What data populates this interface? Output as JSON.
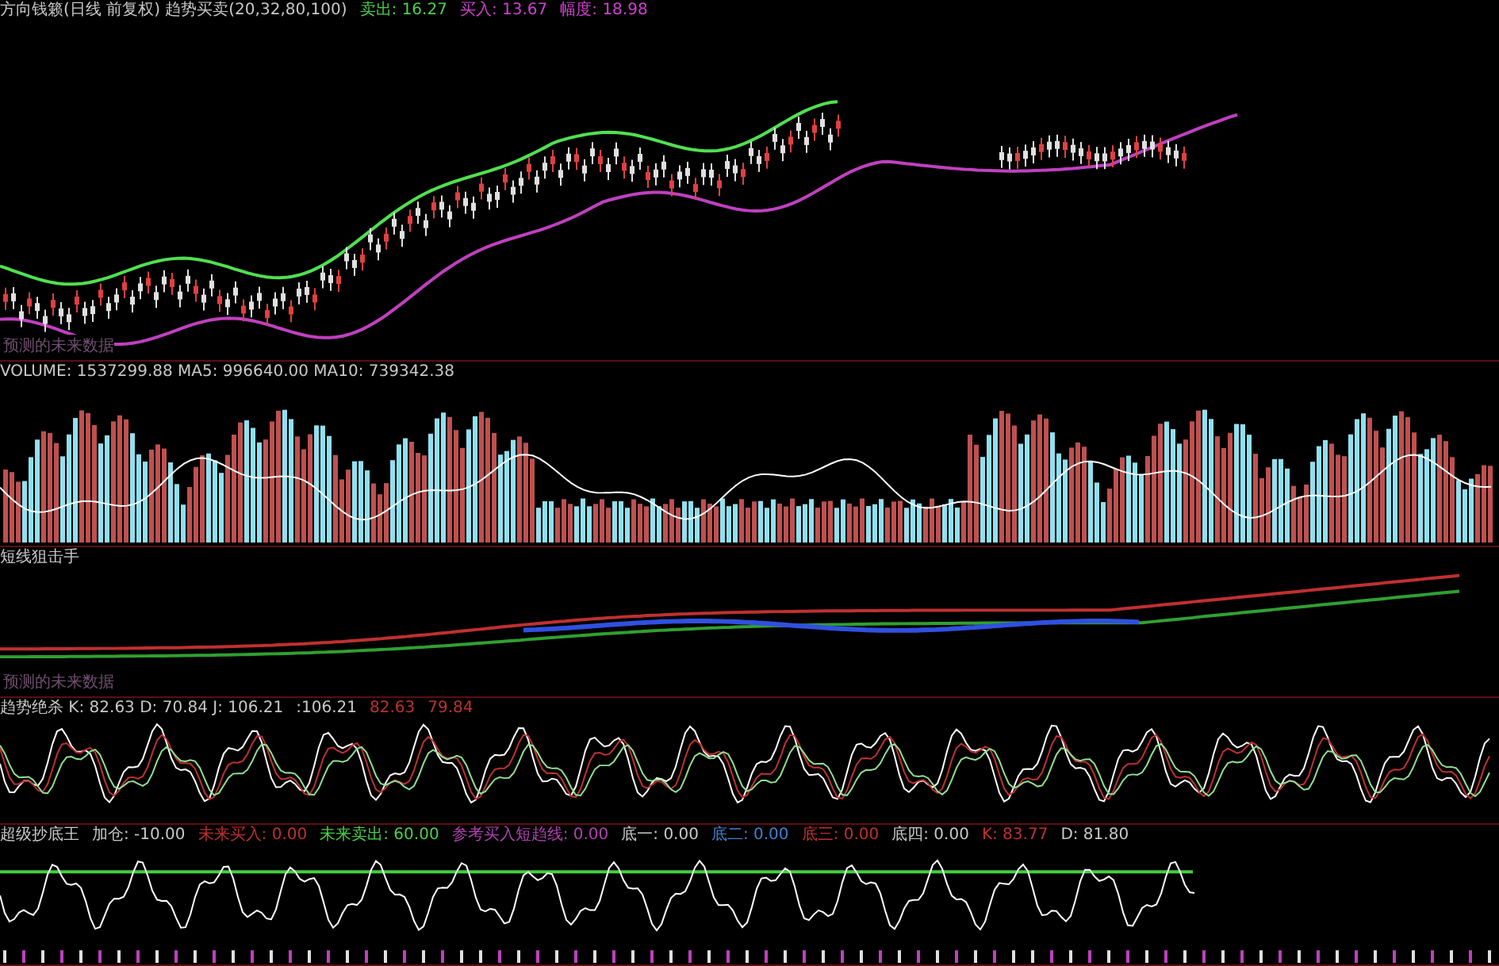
{
  "panels": [
    {
      "kind": "price",
      "header": [
        {
          "text": "方向钱籁(日线 前复权) 趋势买卖(20,32,80,100)",
          "color": "#c8c8c8"
        },
        {
          "text": "卖出: 16.27",
          "color": "#4ad04a"
        },
        {
          "text": "买入: 13.67",
          "color": "#d040d0"
        },
        {
          "text": "幅度: 18.98",
          "color": "#d040d0"
        }
      ],
      "footer": "预测的未来数据"
    },
    {
      "kind": "volume",
      "header": [
        {
          "text": "VOLUME: 1537299.88 MA5: 996640.00 MA10: 739342.38",
          "color": "#c8c8c8"
        }
      ]
    },
    {
      "kind": "trend",
      "header": [
        {
          "text": "短线狙击手",
          "color": "#c8c8c8"
        }
      ],
      "footer": "预测的未来数据"
    },
    {
      "kind": "kdj",
      "header": [
        {
          "text": "趋势绝杀 K: 82.63 D: 70.84 J: 106.21",
          "color": "#c8c8c8"
        },
        {
          "text": ":106.21",
          "color": "#c8c8c8"
        },
        {
          "text": "82.63",
          "color": "#c03030"
        },
        {
          "text": "79.84",
          "color": "#c03030"
        }
      ]
    },
    {
      "kind": "bottom",
      "header": [
        {
          "text": "超级抄底王",
          "color": "#c8c8c8"
        },
        {
          "text": "加仓: -10.00",
          "color": "#c8c8c8"
        },
        {
          "text": "未来买入: 0.00",
          "color": "#c03030"
        },
        {
          "text": "未来卖出: 60.00",
          "color": "#4ad04a"
        },
        {
          "text": "参考买入短趋线: 0.00",
          "color": "#b040b0"
        },
        {
          "text": "底一: 0.00",
          "color": "#c8c8c8"
        },
        {
          "text": "底二: 0.00",
          "color": "#4080d0"
        },
        {
          "text": "底三: 0.00",
          "color": "#c03030"
        },
        {
          "text": "底四: 0.00",
          "color": "#c8c8c8"
        },
        {
          "text": "K: 83.77",
          "color": "#c03030"
        },
        {
          "text": "D: 81.80",
          "color": "#c8c8c8"
        }
      ]
    }
  ]
}
